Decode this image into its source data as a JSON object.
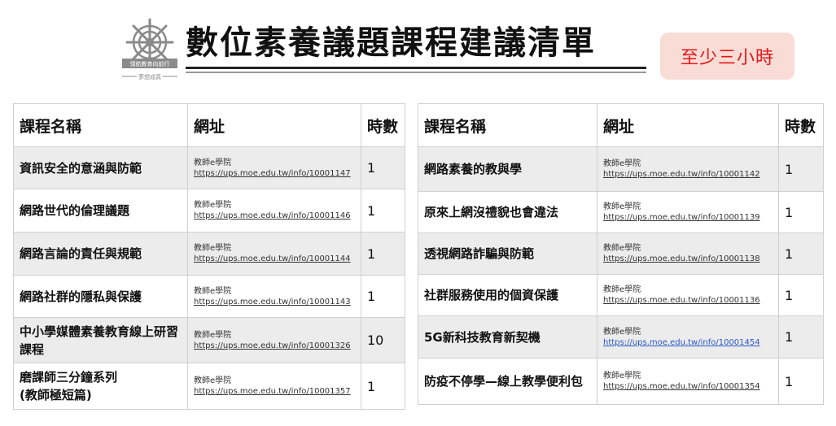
{
  "logo": {
    "caption_top": "領航教育向前行",
    "caption_bottom": "夢想成真"
  },
  "title": "數位素養議題課程建議清單",
  "badge": "至少三小時",
  "table_headers": {
    "name": "課程名稱",
    "url": "網址",
    "hours": "時數"
  },
  "left_rows": [
    {
      "name": "資訊安全的意涵與防範",
      "site": "教師e學院",
      "url": "https://ups.moe.edu.tw/info/10001147",
      "hours": "1"
    },
    {
      "name": "網路世代的倫理議題",
      "site": "教師e學院",
      "url": "https://ups.moe.edu.tw/info/10001146",
      "hours": "1"
    },
    {
      "name": "網路言論的責任與規範",
      "site": "教師e學院",
      "url": "https://ups.moe.edu.tw/info/10001144",
      "hours": "1"
    },
    {
      "name": "網路社群的隱私與保護",
      "site": "教師e學院",
      "url": "https://ups.moe.edu.tw/info/10001143",
      "hours": "1"
    },
    {
      "name": "中小學媒體素養教育線上研習課程",
      "site": "教師e學院",
      "url": "https://ups.moe.edu.tw/info/10001326",
      "hours": "10"
    },
    {
      "name": "磨課師三分鐘系列\n(教師極短篇)",
      "site": "教師e學院",
      "url": "https://ups.moe.edu.tw/info/10001357",
      "hours": "1"
    }
  ],
  "right_rows": [
    {
      "name": "網路素養的教與學",
      "site": "教師e學院",
      "url": "https://ups.moe.edu.tw/info/10001142",
      "hours": "1"
    },
    {
      "name": "原來上網沒禮貌也會違法",
      "site": "教師e學院",
      "url": "https://ups.moe.edu.tw/info/10001139",
      "hours": "1"
    },
    {
      "name": "透視網路詐騙與防範",
      "site": "教師e學院",
      "url": "https://ups.moe.edu.tw/info/10001138",
      "hours": "1"
    },
    {
      "name": "社群服務使用的個資保護",
      "site": "教師e學院",
      "url": "https://ups.moe.edu.tw/info/10001136",
      "hours": "1"
    },
    {
      "name": "5G新科技教育新契機",
      "site": "教師e學院",
      "url": "https://ups.moe.edu.tw/info/10001454",
      "hours": "1"
    },
    {
      "name": "防疫不停學—線上教學便利包",
      "site": "教師e學院",
      "url": "https://ups.moe.edu.tw/info/10001354",
      "hours": "1"
    }
  ],
  "colors": {
    "badge_bg": "#f9dcd6",
    "badge_text": "#e11818",
    "row_alt": "#ececec",
    "link_blue": "#2b57c6"
  }
}
